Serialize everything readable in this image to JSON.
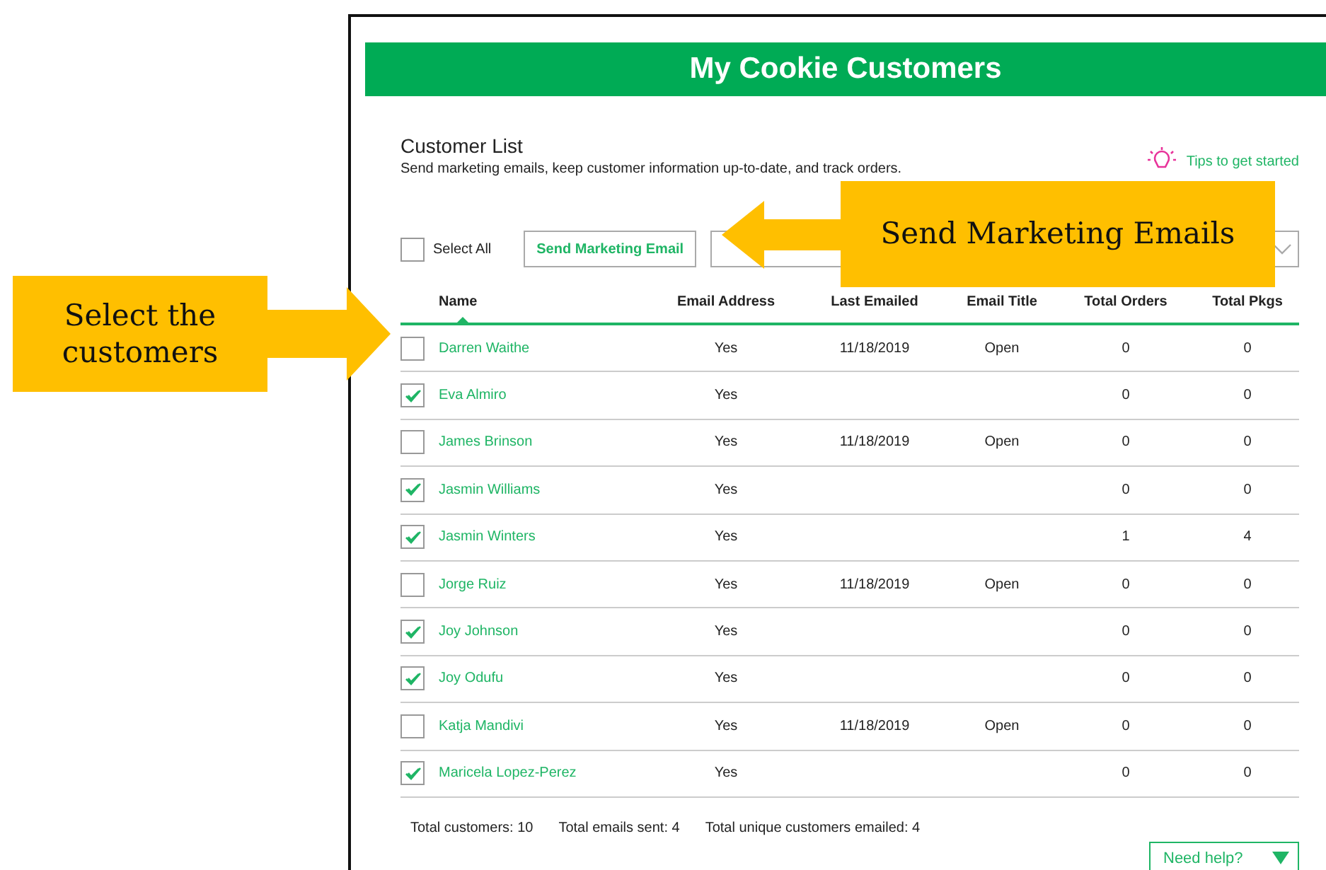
{
  "app": {
    "title": "My Cookie Customers"
  },
  "intro": {
    "heading": "Customer List",
    "description": "Send marketing emails, keep customer information up-to-date, and track orders.",
    "tips_link": "Tips to get started"
  },
  "toolbar": {
    "select_all": {
      "label": "Select All",
      "checked": false
    },
    "send_button": "Send Marketing Email"
  },
  "table": {
    "columns": [
      {
        "label": "Name",
        "sorted": true
      },
      {
        "label": "Email Address",
        "sorted": false
      },
      {
        "label": "Last Emailed",
        "sorted": false
      },
      {
        "label": "Email Title",
        "sorted": false
      },
      {
        "label": "Total Orders",
        "sorted": false
      },
      {
        "label": "Total Pkgs",
        "sorted": false
      }
    ],
    "rows": [
      {
        "checked": false,
        "name": "Darren Waithe",
        "email_address": "Yes",
        "last_emailed": "11/18/2019",
        "email_title": "Open",
        "total_orders": "0",
        "total_pkgs": "0"
      },
      {
        "checked": true,
        "name": "Eva Almiro",
        "email_address": "Yes",
        "last_emailed": "",
        "email_title": "",
        "total_orders": "0",
        "total_pkgs": "0"
      },
      {
        "checked": false,
        "name": "James Brinson",
        "email_address": "Yes",
        "last_emailed": "11/18/2019",
        "email_title": "Open",
        "total_orders": "0",
        "total_pkgs": "0"
      },
      {
        "checked": true,
        "name": "Jasmin Williams",
        "email_address": "Yes",
        "last_emailed": "",
        "email_title": "",
        "total_orders": "0",
        "total_pkgs": "0"
      },
      {
        "checked": true,
        "name": "Jasmin Winters",
        "email_address": "Yes",
        "last_emailed": "",
        "email_title": "",
        "total_orders": "1",
        "total_pkgs": "4"
      },
      {
        "checked": false,
        "name": "Jorge Ruiz",
        "email_address": "Yes",
        "last_emailed": "11/18/2019",
        "email_title": "Open",
        "total_orders": "0",
        "total_pkgs": "0"
      },
      {
        "checked": true,
        "name": "Joy Johnson",
        "email_address": "Yes",
        "last_emailed": "",
        "email_title": "",
        "total_orders": "0",
        "total_pkgs": "0"
      },
      {
        "checked": true,
        "name": "Joy Odufu",
        "email_address": "Yes",
        "last_emailed": "",
        "email_title": "",
        "total_orders": "0",
        "total_pkgs": "0"
      },
      {
        "checked": false,
        "name": "Katja Mandivi",
        "email_address": "Yes",
        "last_emailed": "11/18/2019",
        "email_title": "Open",
        "total_orders": "0",
        "total_pkgs": "0"
      },
      {
        "checked": true,
        "name": "Maricela Lopez-Perez",
        "email_address": "Yes",
        "last_emailed": "",
        "email_title": "",
        "total_orders": "0",
        "total_pkgs": "0"
      }
    ]
  },
  "summary": [
    "Total customers: 10",
    "Total emails sent: 4",
    "Total unique customers emailed: 4"
  ],
  "help_button": "Need help?",
  "callouts": [
    {
      "text": "Send Marketing Emails"
    },
    {
      "text": "Select the customers"
    }
  ]
}
